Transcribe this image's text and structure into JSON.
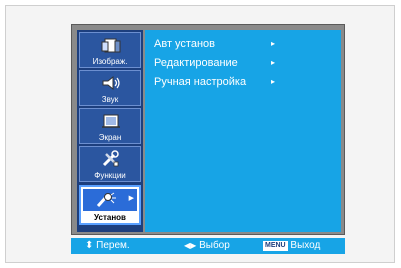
{
  "sidebar": {
    "items": [
      {
        "label": "Изображ.",
        "icon": "picture-icon"
      },
      {
        "label": "Звук",
        "icon": "sound-icon"
      },
      {
        "label": "Экран",
        "icon": "screen-icon"
      },
      {
        "label": "Функции",
        "icon": "functions-icon"
      },
      {
        "label": "Установ",
        "icon": "setup-icon",
        "active": true
      }
    ]
  },
  "menu": {
    "items": [
      {
        "label": "Авт установ",
        "arrow": "▸"
      },
      {
        "label": "Редактирование",
        "arrow": "▸"
      },
      {
        "label": "Ручная настройка",
        "arrow": "▸"
      }
    ]
  },
  "status": {
    "move": "Перем.",
    "select": "Выбор",
    "menu_key": "MENU",
    "exit": "Выход"
  },
  "colors": {
    "main_bg": "#17a4e6",
    "sidebar_bg": "#1d3f7e",
    "frame_bg": "#8a8a8a"
  }
}
